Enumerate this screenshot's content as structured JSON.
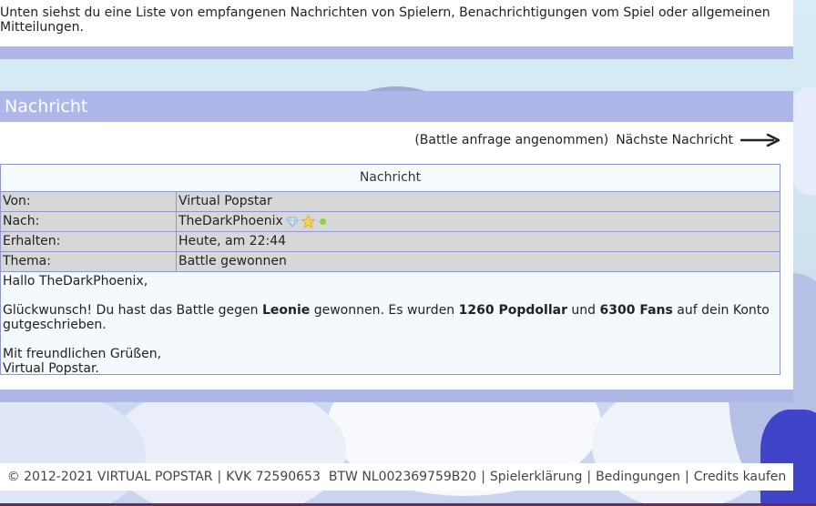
{
  "intro": {
    "text": "Unten siehst du eine Liste von empfangenen Nachrichten von Spielern, Benachrichtigungen vom Spiel oder allgemeinen Mitteilungen."
  },
  "message": {
    "section_title": "Nachricht",
    "nav": {
      "previous_subject": "(Battle anfrage angenommen)",
      "next_label": "Nächste Nachricht",
      "arrow_icon": "arrow-right-icon"
    },
    "table_title": "Nachricht",
    "fields": [
      {
        "label": "Von:",
        "value": "Virtual Popstar"
      },
      {
        "label": "Nach:",
        "value": "TheDarkPhoenix",
        "icons": [
          "diamond-icon",
          "star-icon",
          "online-dot-icon"
        ]
      },
      {
        "label": "Erhalten:",
        "value": "Heute, am 22:44"
      },
      {
        "label": "Thema:",
        "value": "Battle gewonnen"
      }
    ],
    "body": {
      "greeting": "Hallo TheDarkPhoenix,",
      "line_part1": "Glückwunsch! Du hast das Battle gegen ",
      "opponent": "Leonie",
      "line_part2": " gewonnen. Es wurden ",
      "popdollar": "1260 Popdollar",
      "line_part3": " und ",
      "fans": "6300 Fans",
      "line_part4": " auf dein Konto gutgeschrieben.",
      "closing": "Mit freundlichen Grüßen,",
      "signature": "Virtual Popstar."
    }
  },
  "footer": {
    "copyright": "© 2012-2021 VIRTUAL POPSTAR",
    "kvk": "KVK 72590653",
    "btw": "BTW NL002369759B20",
    "links": [
      "Spielerklärung",
      "Bedingungen",
      "Credits kaufen"
    ]
  },
  "colors": {
    "header_bar": "#afb7e8",
    "table_border": "#8e99c9",
    "row_bg": "#d7d7d7",
    "online_dot": "#8bd43a"
  }
}
